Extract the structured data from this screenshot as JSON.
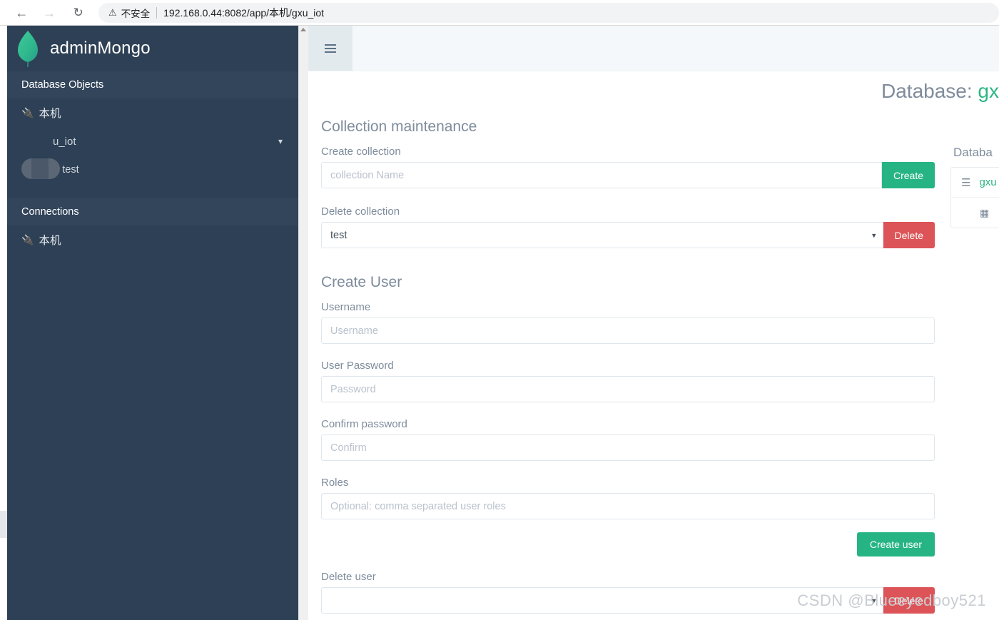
{
  "browser": {
    "back_icon": "arrow-left",
    "forward_icon": "arrow-right",
    "reload_icon": "reload",
    "warning_icon": "warning-triangle",
    "security_label": "不安全",
    "url": "192.168.0.44:8082/app/本机/gxu_iot"
  },
  "sidebar": {
    "brand": "adminMongo",
    "logo_icon": "mongodb-leaf-icon",
    "sections": [
      {
        "title": "Database Objects",
        "items": [
          {
            "label": "本机",
            "icon": "plug-icon",
            "type": "connection"
          },
          {
            "label": "u_iot",
            "icon": "database-icon",
            "type": "database",
            "chevron": "chevron-down-icon",
            "redacted": true
          },
          {
            "label": "test",
            "icon": "table-grid-icon",
            "type": "collection"
          }
        ]
      },
      {
        "title": "Connections",
        "items": [
          {
            "label": "本机",
            "icon": "plug-icon",
            "type": "connection"
          }
        ]
      }
    ]
  },
  "topbar": {
    "menu_toggle_icon": "hamburger-icon"
  },
  "header": {
    "prefix": "Database: ",
    "database_name": "gx",
    "accent_color": "#2bb681"
  },
  "main": {
    "collection_section": {
      "title": "Collection maintenance",
      "create_label": "Create collection",
      "create_placeholder": "collection Name",
      "create_value": "",
      "create_button": "Create",
      "delete_label": "Delete collection",
      "delete_selected": "test",
      "delete_options": [
        "test"
      ],
      "delete_button": "Delete"
    },
    "user_section": {
      "title": "Create User",
      "username_label": "Username",
      "username_placeholder": "Username",
      "username_value": "",
      "password_label": "User Password",
      "password_placeholder": "Password",
      "password_value": "",
      "confirm_label": "Confirm password",
      "confirm_placeholder": "Confirm",
      "confirm_value": "",
      "roles_label": "Roles",
      "roles_placeholder": "Optional: comma separated user roles",
      "roles_value": "",
      "create_user_button": "Create user",
      "delete_user_label": "Delete user",
      "delete_user_selected": "",
      "delete_user_options": [
        ""
      ],
      "delete_user_button": "Delete"
    }
  },
  "right_panel": {
    "label": "Databa",
    "rows": [
      {
        "icon": "database-stack-icon",
        "label": "gxu"
      },
      {
        "icon": "table-grid-icon",
        "label": ""
      }
    ]
  },
  "watermark": "CSDN @Blueeyedboy521"
}
